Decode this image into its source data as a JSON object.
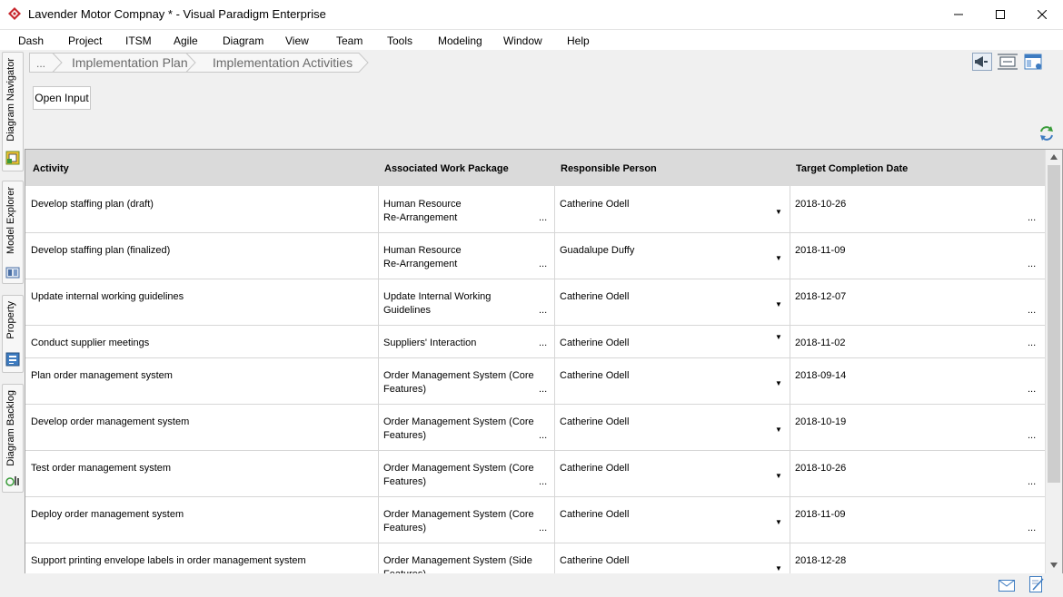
{
  "window": {
    "title": "Lavender Motor Compnay * - Visual Paradigm Enterprise",
    "brand_color": "#c8282e"
  },
  "menu": [
    "Dash",
    "Project",
    "ITSM",
    "Agile",
    "Diagram",
    "View",
    "Team",
    "Tools",
    "Modeling",
    "Window",
    "Help"
  ],
  "sidebar": {
    "tabs": [
      {
        "label": "Diagram Navigator",
        "icon": "diagram-navigator-icon"
      },
      {
        "label": "Model Explorer",
        "icon": "model-explorer-icon"
      },
      {
        "label": "Property",
        "icon": "property-icon"
      },
      {
        "label": "Diagram Backlog",
        "icon": "diagram-backlog-icon"
      }
    ]
  },
  "breadcrumb": {
    "ellipsis": "...",
    "items": [
      "Implementation Plan",
      "Implementation Activities"
    ]
  },
  "toolbar": {
    "open_input": "Open Input"
  },
  "table": {
    "headers": [
      "Activity",
      "Associated Work Package",
      "Responsible Person",
      "Target Completion Date"
    ],
    "more_glyph": "...",
    "dropdown_glyph": "▼",
    "rows": [
      {
        "activity": "Develop staffing plan (draft)",
        "wp1": "Human Resource",
        "wp2": "Re-Arrangement",
        "person": "Catherine Odell",
        "date": "2018-10-26"
      },
      {
        "activity": "Develop staffing plan (finalized)",
        "wp1": "Human Resource",
        "wp2": "Re-Arrangement",
        "person": "Guadalupe Duffy",
        "date": "2018-11-09"
      },
      {
        "activity": "Update internal working guidelines",
        "wp1": "Update Internal Working",
        "wp2": "Guidelines",
        "person": "Catherine Odell",
        "date": "2018-12-07"
      },
      {
        "activity": "Conduct supplier meetings",
        "wp1": "Suppliers' Interaction",
        "wp2": "",
        "person": "Catherine Odell",
        "date": "2018-11-02"
      },
      {
        "activity": "Plan order management system",
        "wp1": "Order Management System (Core",
        "wp2": "Features)",
        "person": "Catherine Odell",
        "date": "2018-09-14"
      },
      {
        "activity": "Develop order management system",
        "wp1": "Order Management System (Core",
        "wp2": "Features)",
        "person": "Catherine Odell",
        "date": "2018-10-19"
      },
      {
        "activity": "Test order management system",
        "wp1": "Order Management System (Core",
        "wp2": "Features)",
        "person": "Catherine Odell",
        "date": "2018-10-26"
      },
      {
        "activity": "Deploy order management system",
        "wp1": "Order Management System (Core",
        "wp2": "Features)",
        "person": "Catherine Odell",
        "date": "2018-11-09"
      },
      {
        "activity": "Support printing envelope labels in order management system",
        "wp1": "Order Management System (Side",
        "wp2": "Features)",
        "person": "Catherine Odell",
        "date": "2018-12-28"
      }
    ]
  }
}
